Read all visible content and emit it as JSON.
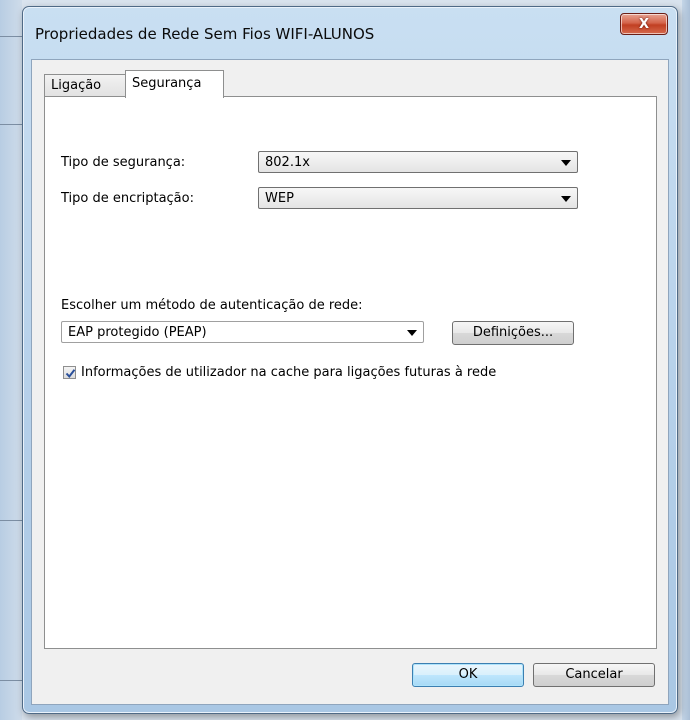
{
  "window": {
    "title": "Propriedades de Rede Sem Fios WIFI-ALUNOS",
    "close_icon": "close-icon",
    "close_glyph": "X"
  },
  "tabs": [
    {
      "label": "Ligação",
      "active": false
    },
    {
      "label": "Segurança",
      "active": true
    }
  ],
  "security": {
    "security_type_label": "Tipo de segurança:",
    "security_type_value": "802.1x",
    "encryption_type_label": "Tipo de encriptação:",
    "encryption_type_value": "WEP",
    "auth_method_label": "Escolher um método de autenticação de rede:",
    "auth_method_value": "EAP protegido (PEAP)",
    "settings_button": "Definições...",
    "cache_checkbox_label": "Informações de utilizador na cache para ligações futuras à rede",
    "cache_checkbox_checked": true
  },
  "footer": {
    "ok": "OK",
    "cancel": "Cancelar"
  },
  "colors": {
    "accent": "#3c7fb1",
    "close_red": "#c13f22"
  }
}
